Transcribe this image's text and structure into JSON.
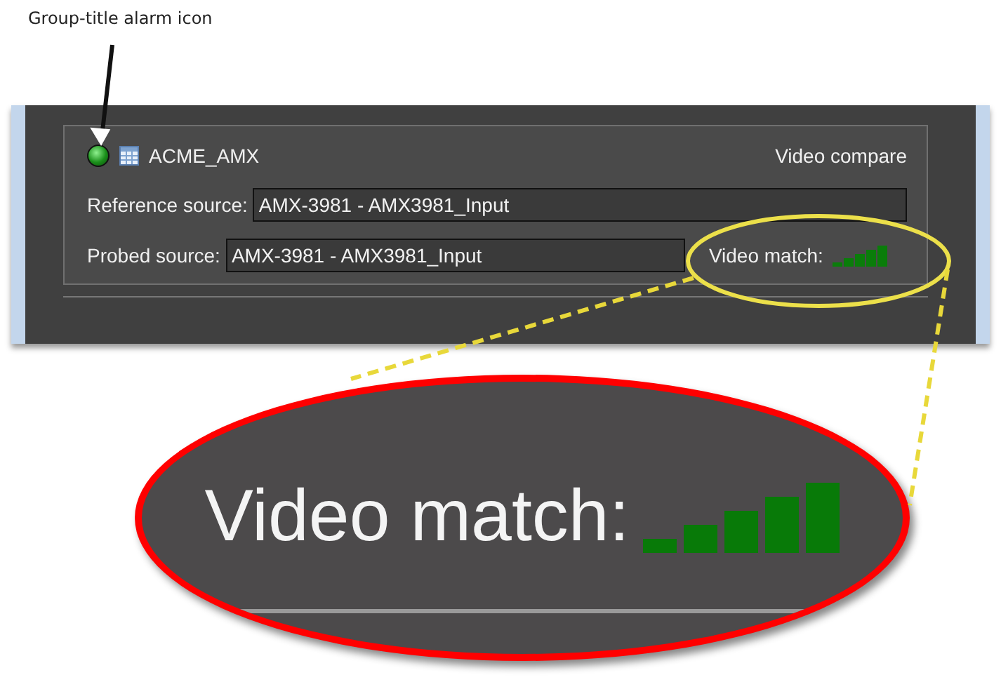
{
  "annotation": {
    "label": "Group-title alarm icon"
  },
  "group": {
    "title": "ACME_AMX",
    "type": "Video compare",
    "fields": [
      {
        "label": "Reference source:",
        "value": "AMX-3981 - AMX3981_Input"
      },
      {
        "label": "Probed source:",
        "value": "AMX-3981 - AMX3981_Input"
      }
    ],
    "match": {
      "label": "Video match:",
      "level": 1
    }
  },
  "zoom": {
    "label": "Video match:",
    "level": 1
  }
}
